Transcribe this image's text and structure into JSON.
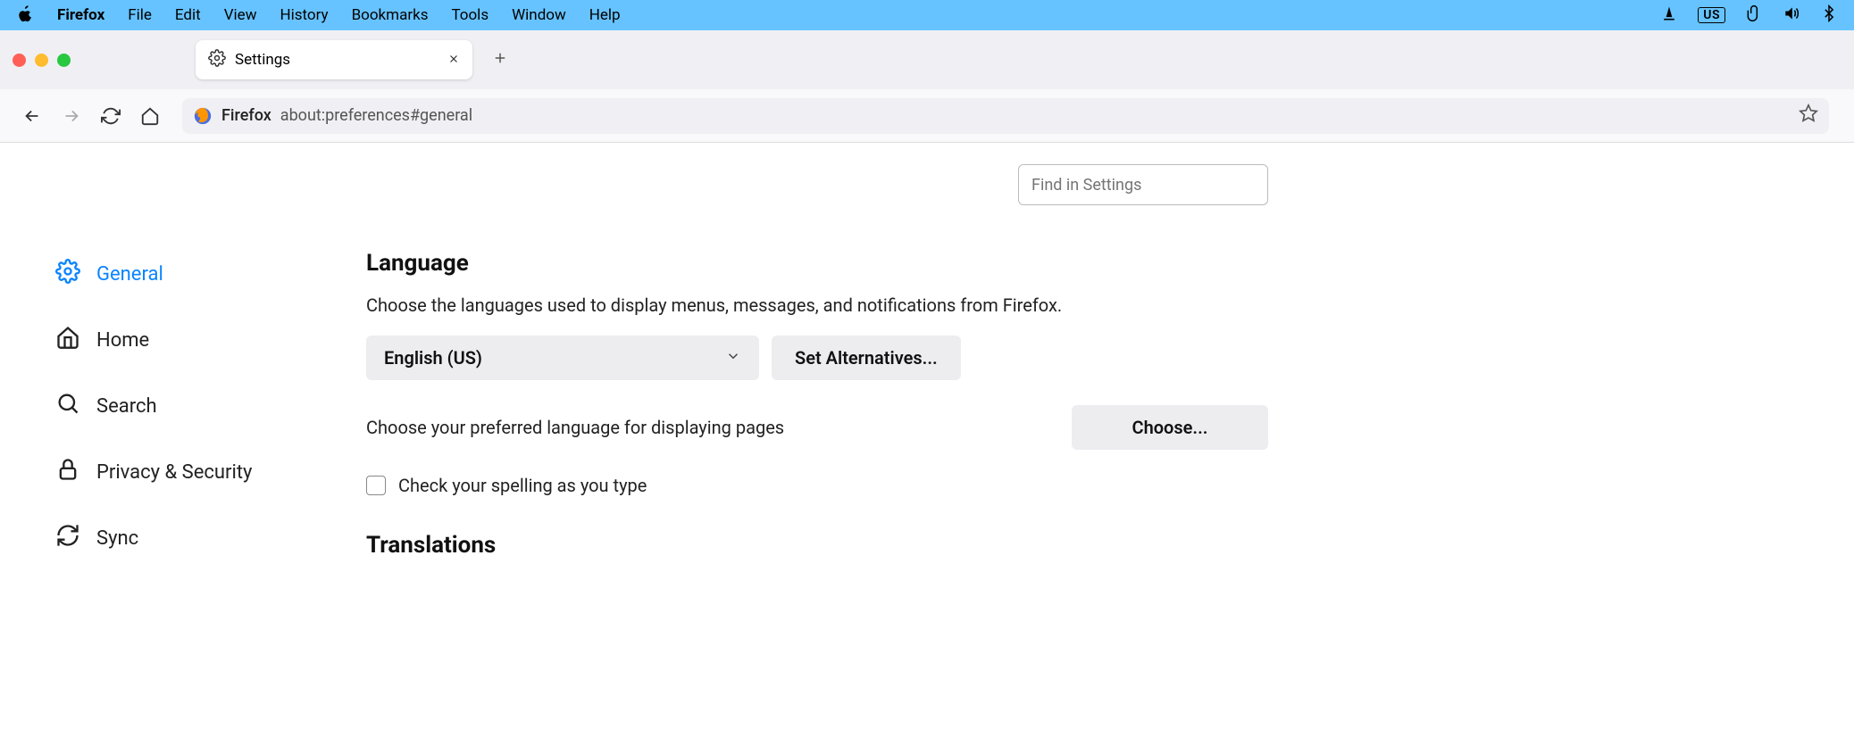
{
  "menubar": {
    "app_name": "Firefox",
    "items": [
      "File",
      "Edit",
      "View",
      "History",
      "Bookmarks",
      "Tools",
      "Window",
      "Help"
    ],
    "input_indicator": "US"
  },
  "tab": {
    "title": "Settings"
  },
  "urlbar": {
    "identity": "Firefox",
    "url": "about:preferences#general"
  },
  "search": {
    "placeholder": "Find in Settings"
  },
  "sidebar": {
    "items": [
      {
        "label": "General"
      },
      {
        "label": "Home"
      },
      {
        "label": "Search"
      },
      {
        "label": "Privacy & Security"
      },
      {
        "label": "Sync"
      }
    ]
  },
  "language": {
    "heading": "Language",
    "desc": "Choose the languages used to display menus, messages, and notifications from Firefox.",
    "selected": "English (US)",
    "set_alt": "Set Alternatives...",
    "pref_desc": "Choose your preferred language for displaying pages",
    "choose": "Choose...",
    "spellcheck": "Check your spelling as you type"
  },
  "translations": {
    "heading": "Translations"
  }
}
